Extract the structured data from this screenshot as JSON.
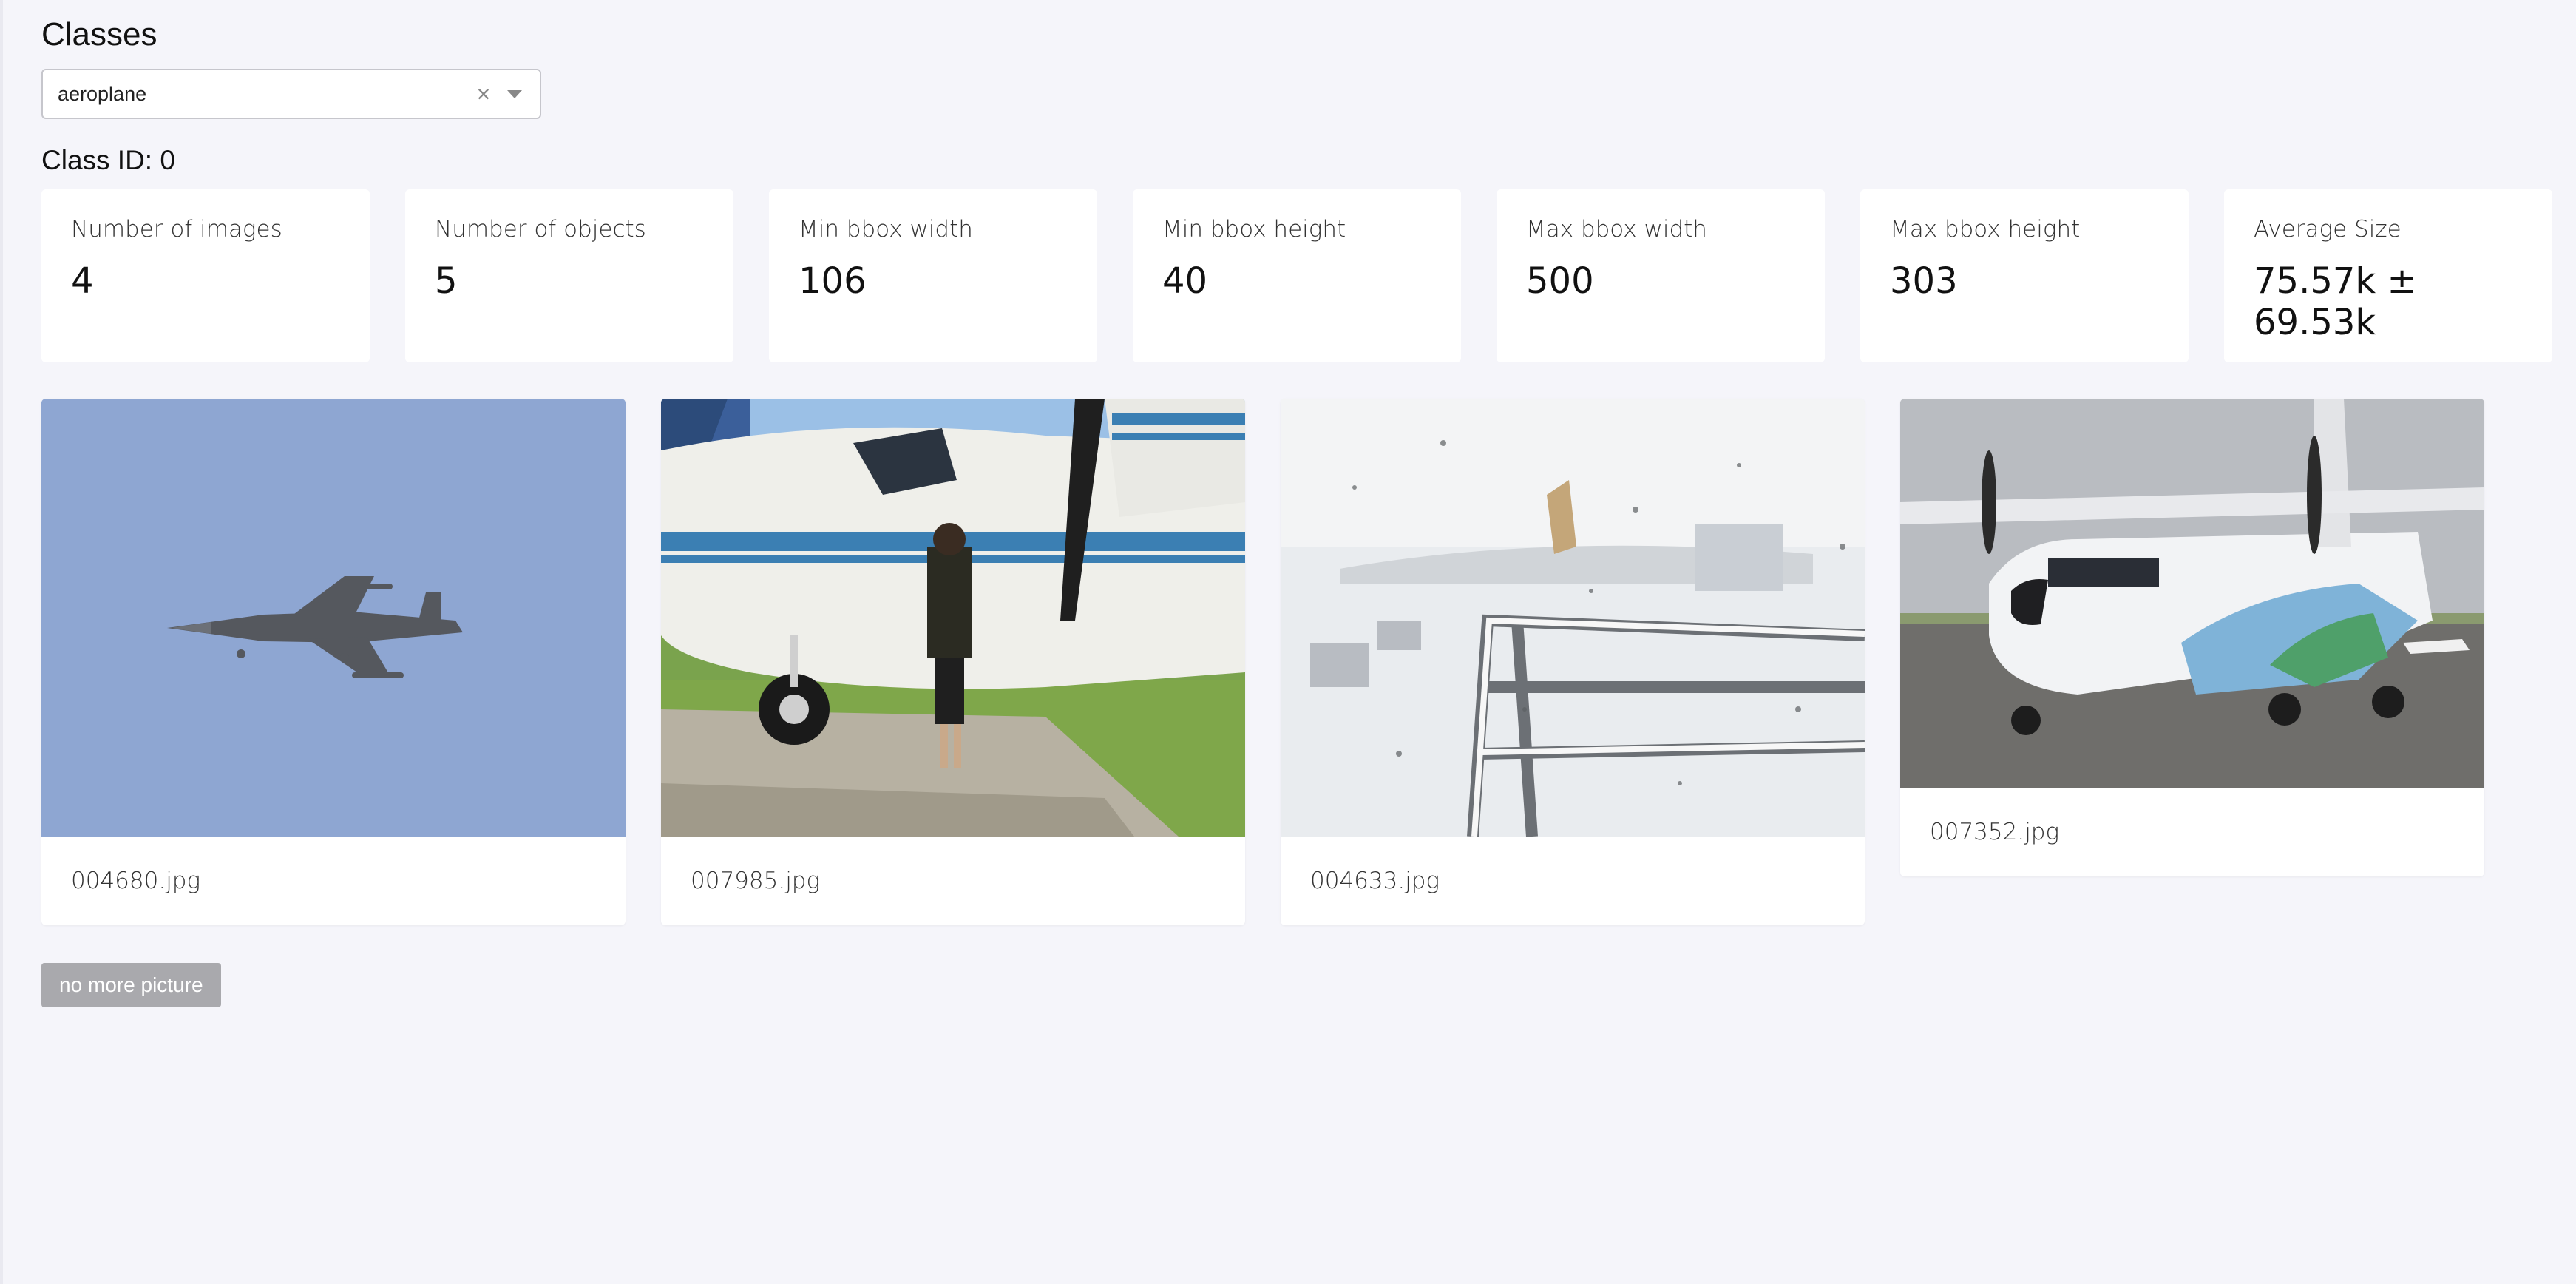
{
  "header": {
    "title": "Classes"
  },
  "class_select": {
    "value": "aeroplane",
    "clear_symbol": "×"
  },
  "class_id_label": "Class ID: 0",
  "stats": [
    {
      "label": "Number of images",
      "value": "4"
    },
    {
      "label": "Number of objects",
      "value": "5"
    },
    {
      "label": "Min bbox width",
      "value": "106"
    },
    {
      "label": "Min bbox height",
      "value": "40"
    },
    {
      "label": "Max bbox width",
      "value": "500"
    },
    {
      "label": "Max bbox height",
      "value": "303"
    },
    {
      "label": "Average Size",
      "value": "75.57k ± 69.53k"
    }
  ],
  "images": [
    {
      "filename": "004680.jpg",
      "scene": "fighter-jet-sky"
    },
    {
      "filename": "007985.jpg",
      "scene": "person-by-propeller-plane"
    },
    {
      "filename": "004633.jpg",
      "scene": "snowy-window-airport"
    },
    {
      "filename": "007352.jpg",
      "scene": "painted-cargo-plane"
    }
  ],
  "load_button": {
    "label": "no more picture"
  },
  "colors": {
    "background": "#f5f5fa",
    "card": "#ffffff",
    "button_disabled": "#a9a9ad"
  }
}
